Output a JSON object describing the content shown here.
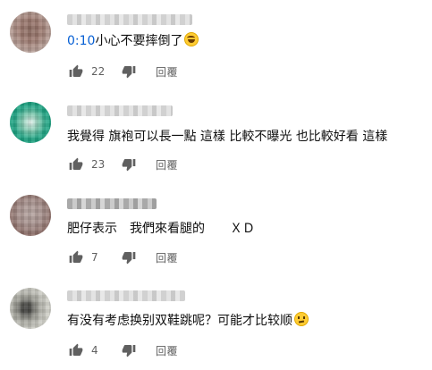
{
  "comments": [
    {
      "timestamp_link": "0:10",
      "text": "小心不要摔倒了",
      "emoji": "laughing-face-emoji",
      "likes": "22",
      "reply_label": "回覆"
    },
    {
      "text": "我覺得 旗袍可以長一點 這樣 比較不曝光 也比較好看 這樣",
      "likes": "23",
      "reply_label": "回覆"
    },
    {
      "text": "肥仔表示　我們來看腿的　　ＸＤ",
      "likes": "7",
      "reply_label": "回覆"
    },
    {
      "text": "有没有考虑换别双鞋跳呢？可能才比较顺",
      "emoji": "thinking-face-emoji",
      "likes": "4",
      "reply_label": "回覆"
    }
  ],
  "colors": {
    "link": "#065fd4",
    "text": "#0f0f0f",
    "secondary": "#606060"
  },
  "icons": {
    "like": "thumbs-up-icon",
    "dislike": "thumbs-down-icon"
  }
}
